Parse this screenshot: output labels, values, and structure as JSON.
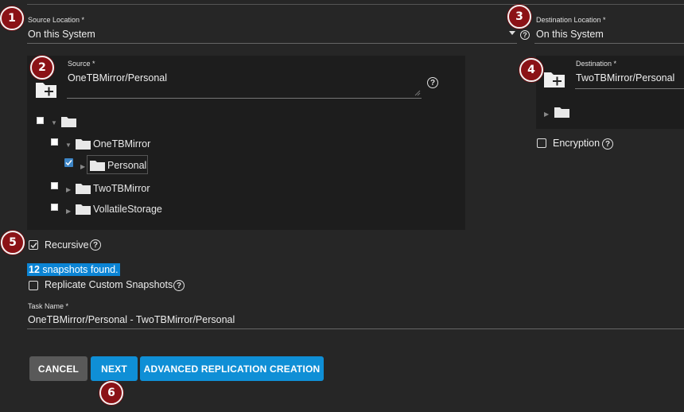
{
  "source_location": {
    "label": "Source Location *",
    "value": "On this System"
  },
  "destination_location": {
    "label": "Destination Location *",
    "value": "On this System"
  },
  "source": {
    "label": "Source *",
    "value": "OneTBMirror/Personal",
    "tree": {
      "level1": [
        "OneTBMirror",
        "TwoTBMirror",
        "VollatileStorage"
      ],
      "selected_child": "Personal"
    }
  },
  "destination": {
    "label": "Destination *",
    "value": "TwoTBMirror/Personal"
  },
  "encryption": {
    "label": "Encryption"
  },
  "recursive": {
    "label": "Recursive"
  },
  "snapshots": {
    "count": "12",
    "text": "snapshots found."
  },
  "replicate_custom": {
    "label": "Replicate Custom Snapshots"
  },
  "task_name": {
    "label": "Task Name *",
    "value": "OneTBMirror/Personal - TwoTBMirror/Personal"
  },
  "buttons": {
    "cancel": "CANCEL",
    "next": "NEXT",
    "advanced": "ADVANCED REPLICATION CREATION"
  },
  "step_badges": [
    "1",
    "2",
    "3",
    "4",
    "5",
    "6"
  ],
  "colors": {
    "accent": "#0f8fd6",
    "badge": "#8b1216",
    "checkbox": "#3d85c6"
  }
}
